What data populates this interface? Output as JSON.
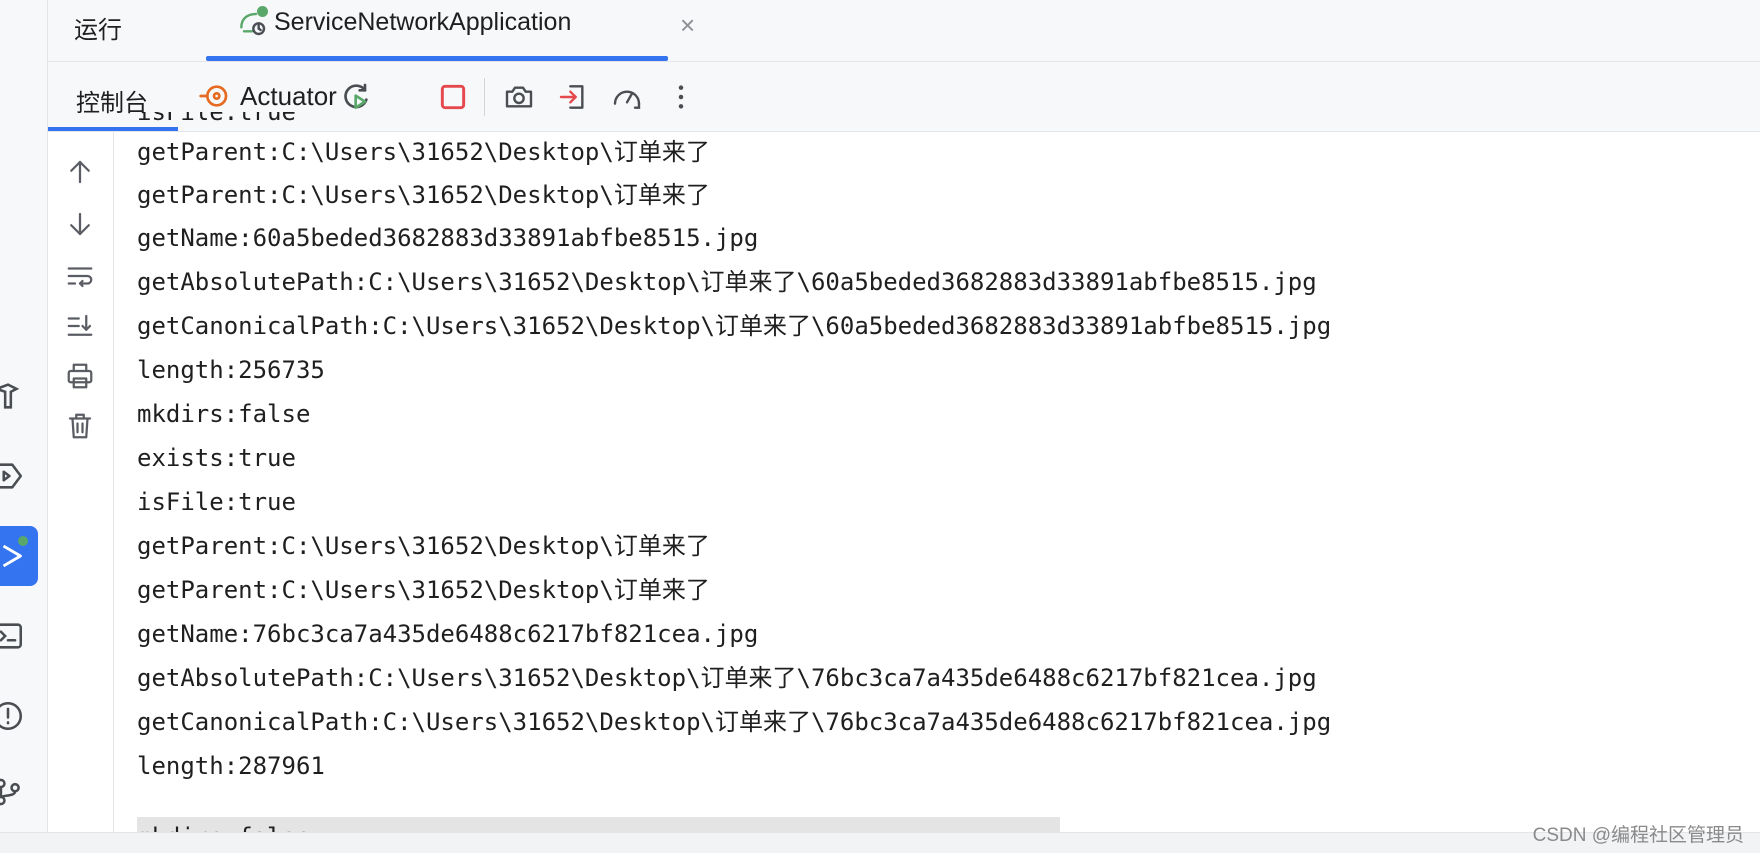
{
  "run_panel": {
    "title": "运行",
    "tab_label": "ServiceNetworkApplication",
    "close_glyph": "×"
  },
  "toolbar": {
    "console_tab": "控制台",
    "actuator_label": "Actuator",
    "icons": [
      "rerun-icon",
      "stop-icon",
      "screenshot-icon",
      "import-icon",
      "profiler-icon",
      "more-icon"
    ]
  },
  "console": {
    "lines": [
      "isFile:true",
      "getParent:C:\\Users\\31652\\Desktop\\订单来了",
      "getParent:C:\\Users\\31652\\Desktop\\订单来了",
      "getName:60a5beded3682883d33891abfbe8515.jpg",
      "getAbsolutePath:C:\\Users\\31652\\Desktop\\订单来了\\60a5beded3682883d33891abfbe8515.jpg",
      "getCanonicalPath:C:\\Users\\31652\\Desktop\\订单来了\\60a5beded3682883d33891abfbe8515.jpg",
      "length:256735",
      "mkdirs:false",
      "exists:true",
      "isFile:true",
      "getParent:C:\\Users\\31652\\Desktop\\订单来了",
      "getParent:C:\\Users\\31652\\Desktop\\订单来了",
      "getName:76bc3ca7a435de6488c6217bf821cea.jpg",
      "getAbsolutePath:C:\\Users\\31652\\Desktop\\订单来了\\76bc3ca7a435de6488c6217bf821cea.jpg",
      "getCanonicalPath:C:\\Users\\31652\\Desktop\\订单来了\\76bc3ca7a435de6488c6217bf821cea.jpg",
      "length:287961",
      "mkdirs:false"
    ]
  },
  "watermark": "CSDN @编程社区管理员",
  "colors": {
    "accent": "#3574f0",
    "run_green": "#59a869",
    "stop_red": "#e5484d",
    "actuator_orange": "#e66a1f"
  }
}
